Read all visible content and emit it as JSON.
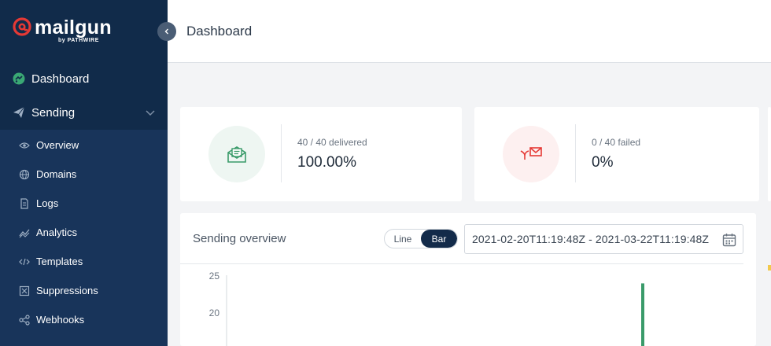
{
  "brand": {
    "name": "mailgun",
    "byline": "by PATHWIRE",
    "accent": "#e53935"
  },
  "sidebar": {
    "top_items": [
      {
        "label": "Dashboard",
        "icon": "dashboard-icon"
      },
      {
        "label": "Sending",
        "icon": "paper-plane-icon",
        "expanded": true
      }
    ],
    "sub_items": [
      {
        "label": "Overview",
        "icon": "eye-icon"
      },
      {
        "label": "Domains",
        "icon": "globe-icon"
      },
      {
        "label": "Logs",
        "icon": "document-icon"
      },
      {
        "label": "Analytics",
        "icon": "trend-icon"
      },
      {
        "label": "Templates",
        "icon": "code-icon"
      },
      {
        "label": "Suppressions",
        "icon": "block-icon"
      },
      {
        "label": "Webhooks",
        "icon": "share-icon"
      }
    ]
  },
  "header": {
    "title": "Dashboard"
  },
  "stats": {
    "delivered": {
      "label": "40 / 40 delivered",
      "value": "100.00%",
      "color": "#3a9b6a"
    },
    "failed": {
      "label": "0 / 40 failed",
      "value": "0%",
      "color": "#e53935"
    }
  },
  "overview": {
    "title": "Sending overview",
    "toggle": {
      "line_label": "Line",
      "bar_label": "Bar",
      "selected": "Bar"
    },
    "date_range": "2021-02-20T11:19:48Z - 2021-03-22T11:19:48Z"
  },
  "chart_data": {
    "type": "bar",
    "y_ticks": [
      "25",
      "20"
    ],
    "ylim": [
      0,
      25
    ],
    "series": [
      {
        "values": [
          24
        ],
        "color": "#3a9b6a"
      }
    ],
    "grid": false
  }
}
